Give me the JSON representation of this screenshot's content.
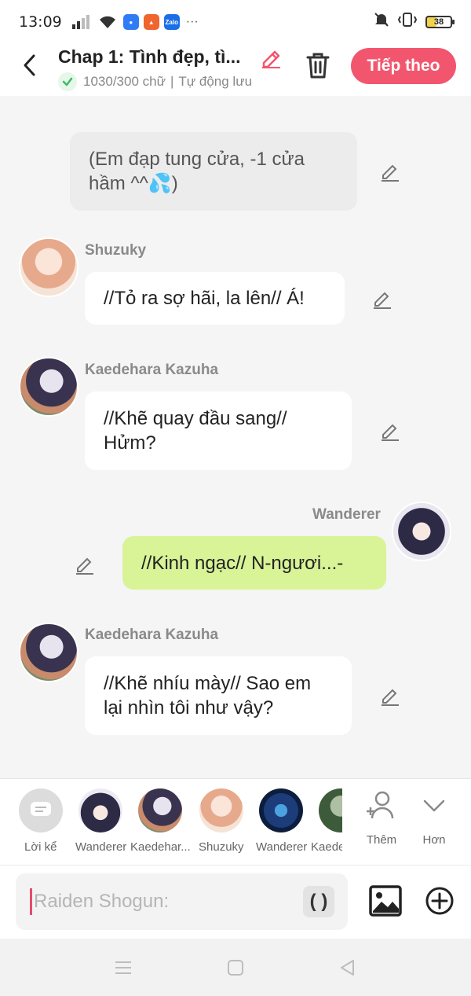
{
  "status": {
    "time": "13:09",
    "battery": "38",
    "apps": [
      "Zalo"
    ]
  },
  "header": {
    "title": "Chap 1: Tình đẹp, tì...",
    "counter": "1030/300 chữ",
    "autosave": "Tự động lưu",
    "next_label": "Tiếp theo"
  },
  "messages": [
    {
      "type": "narration",
      "text": "(Em đạp tung cửa, -1 cửa hầm ^^💦)"
    },
    {
      "type": "left",
      "name": "Shuzuky",
      "text": "//Tỏ ra sợ hãi, la lên// Á!"
    },
    {
      "type": "left",
      "name": "Kaedehara Kazuha",
      "text": "//Khẽ quay đầu sang// Hửm?"
    },
    {
      "type": "right",
      "name": "Wanderer",
      "text": "//Kinh ngạc// N-ngươi...-"
    },
    {
      "type": "left",
      "name": "Kaedehara Kazuha",
      "text": "//Khẽ nhíu mày// Sao em lại nhìn tôi như vậy?"
    }
  ],
  "characters": {
    "suggest": "Lời kể",
    "items": [
      "Wanderer",
      "Kaedehar...",
      "Shuzuky",
      "Wanderer",
      "Kaede"
    ],
    "add": "Thêm",
    "more": "Hơn"
  },
  "input": {
    "placeholder": "Raiden Shogun:",
    "paren": "( )"
  },
  "colors": {
    "accent": "#f2566e",
    "mine_bubble": "#d9f397",
    "narration_bubble": "#ececec"
  }
}
